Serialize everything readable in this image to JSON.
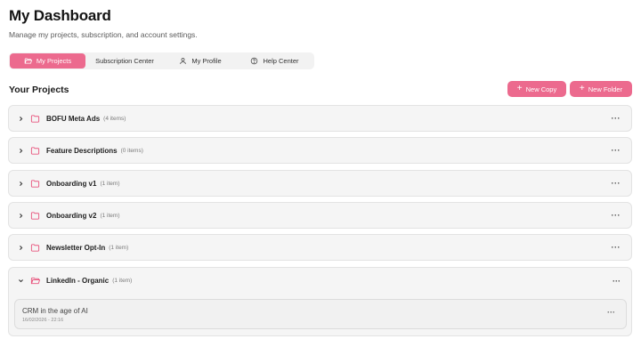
{
  "header": {
    "title": "My Dashboard",
    "subtitle": "Manage my projects, subscription, and account settings."
  },
  "tabs": [
    {
      "label": "My Projects",
      "icon": "folder-open-icon",
      "active": true
    },
    {
      "label": "Subscription Center",
      "icon": "",
      "active": false
    },
    {
      "label": "My Profile",
      "icon": "user-icon",
      "active": false
    },
    {
      "label": "Help Center",
      "icon": "help-circle-icon",
      "active": false
    }
  ],
  "projects": {
    "title": "Your Projects",
    "new_copy_label": "New Copy",
    "new_folder_label": "New Folder",
    "folders": [
      {
        "name": "BOFU Meta Ads",
        "count": "(4 items)",
        "expanded": false
      },
      {
        "name": "Feature Descriptions",
        "count": "(0 items)",
        "expanded": false
      },
      {
        "name": "Onboarding v1",
        "count": "(1 item)",
        "expanded": false
      },
      {
        "name": "Onboarding v2",
        "count": "(1 item)",
        "expanded": false
      },
      {
        "name": "Newsletter Opt-In",
        "count": "(1 item)",
        "expanded": false
      },
      {
        "name": "LinkedIn - Organic",
        "count": "(1 item)",
        "expanded": true,
        "items": [
          {
            "title": "CRM in the age of AI",
            "date": "16/02/2026 - 22:16"
          }
        ]
      }
    ]
  },
  "colors": {
    "accent": "#ec6a8e",
    "folder_icon": "#e8577f"
  }
}
